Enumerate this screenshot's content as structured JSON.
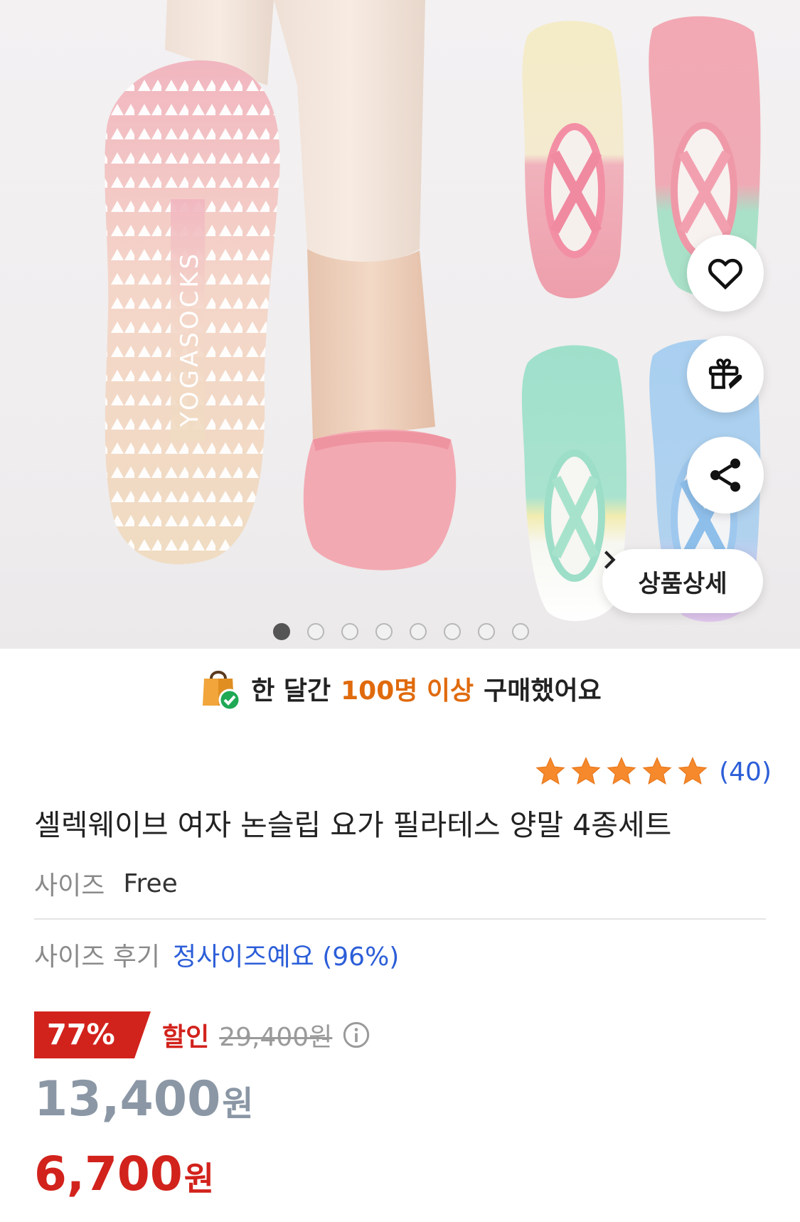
{
  "product_image": {
    "sock_print": "YOGASOCKS",
    "carousel_total": 8,
    "carousel_active": 1,
    "detail_button": {
      "label": "상품상세",
      "chevron": "chevron-right-icon"
    },
    "actions": [
      "heart-icon",
      "gift-icon",
      "share-icon"
    ]
  },
  "banner": {
    "prefix": "한 달간",
    "highlight": "100명 이상",
    "suffix": "구매했어요",
    "icon": "shopping-bag-check-icon",
    "highlight_color": "#e06a0c"
  },
  "rating": {
    "stars": 5,
    "count": "(40)",
    "star_color": "#f5892b"
  },
  "product": {
    "title": "셀렉웨이브 여자 논슬립 요가 필라테스 양말 4종세트"
  },
  "size": {
    "label": "사이즈",
    "value": "Free"
  },
  "size_review": {
    "label": "사이즈 후기",
    "value": "정사이즈예요 (96%)"
  },
  "price": {
    "discount_rate": "77%",
    "discount_label": "할인",
    "original_price": "29,400원",
    "sale_price": "13,400",
    "sale_unit": "원",
    "final_price": "6,700",
    "final_unit": "원",
    "accent": "#d2221c"
  }
}
